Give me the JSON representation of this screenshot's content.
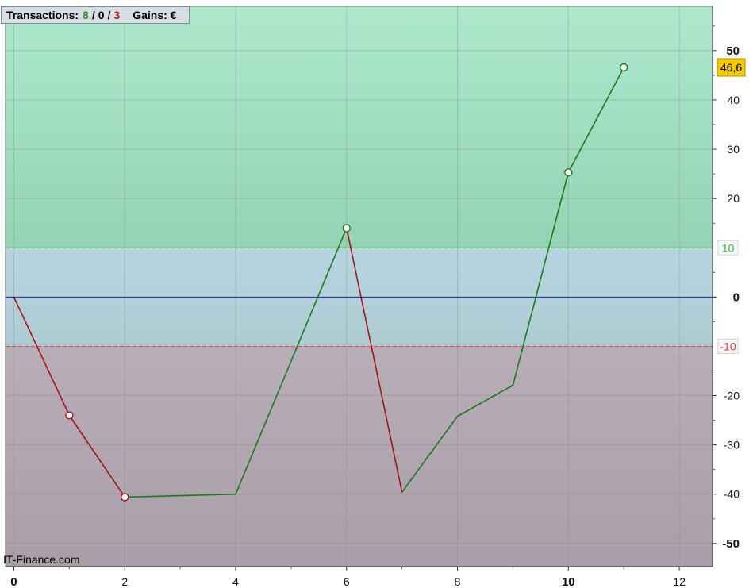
{
  "header": {
    "transactions_label": "Transactions:",
    "wins": "8",
    "separator": "/",
    "neutral": "0",
    "losses": "3",
    "gains_label": "Gains: €"
  },
  "watermark": "IT-Finance.com",
  "colors": {
    "upper_zone": "#a6e4c8",
    "middle_zone": "#b4d2dc",
    "lower_zone": "#b2a6b0",
    "gain_line": "#1a7a1a",
    "loss_line": "#a31515",
    "zero_line": "#1c1cc8",
    "upper_threshold": "#44cc44",
    "lower_threshold": "#e05050",
    "current_value_tag": "#f5c800"
  },
  "chart_data": {
    "type": "line",
    "x": [
      0,
      1,
      2,
      4,
      6,
      7,
      8,
      9,
      10,
      11
    ],
    "y": [
      0,
      -24,
      -40.6,
      -40,
      14,
      -39.6,
      -24.2,
      -17.9,
      25.3,
      46.6
    ],
    "segment_colors": [
      "loss",
      "loss",
      "gain",
      "gain",
      "loss",
      "gain",
      "gain",
      "gain",
      "gain"
    ],
    "markers": [
      {
        "x": 1,
        "y": -24,
        "color": "loss"
      },
      {
        "x": 2,
        "y": -40.6,
        "color": "loss"
      },
      {
        "x": 6,
        "y": 14,
        "color": "gain"
      },
      {
        "x": 10,
        "y": 25.3,
        "color": "gain"
      },
      {
        "x": 11,
        "y": 46.6,
        "color": "gain"
      }
    ],
    "xlim": [
      -0.15,
      12.6
    ],
    "ylim": [
      -54.7,
      59
    ],
    "x_ticks": [
      0,
      2,
      4,
      6,
      8,
      10,
      12
    ],
    "x_tick_labels": [
      "0",
      "2",
      "4",
      "6",
      "8",
      "10",
      "12"
    ],
    "x_bold_ticks": [
      "0",
      "10"
    ],
    "x_minor_ticks": [
      1,
      3,
      5,
      7,
      9,
      11
    ],
    "y_ticks": [
      50,
      40,
      30,
      20,
      0,
      -20,
      -30,
      -40,
      -50
    ],
    "y_tick_labels": [
      "50",
      "40",
      "30",
      "20",
      "0",
      "-20",
      "-30",
      "-40",
      "-50"
    ],
    "y_bold_ticks": [
      "50",
      "0",
      "-50"
    ],
    "thresholds": {
      "upper": 10,
      "lower": -10,
      "upper_label": "10",
      "lower_label": "-10"
    },
    "current_value": 46.6,
    "current_value_label": "46,6",
    "grid": true
  }
}
